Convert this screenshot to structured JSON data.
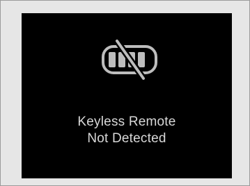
{
  "display": {
    "icon": "keyless-remote-not-detected-icon",
    "message_line1": "Keyless Remote",
    "message_line2": "Not Detected"
  },
  "colors": {
    "screen_background": "#000000",
    "text": "#d8d8d8",
    "icon": "#bdbdbd",
    "frame_background": "#e6e6e6",
    "frame_border": "#9a9a9a"
  }
}
